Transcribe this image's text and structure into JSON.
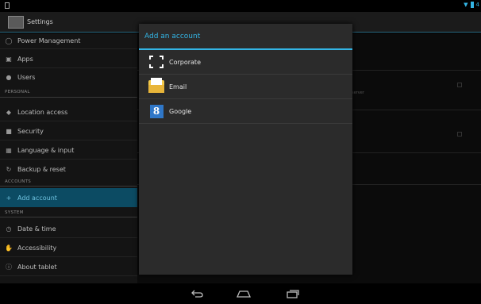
{
  "status_bar": {
    "notification_icon": "notification-icon",
    "wifi_icon": "wifi-icon",
    "battery_icon": "battery-icon",
    "clock": "4"
  },
  "action_bar": {
    "title": "Settings"
  },
  "sidebar": {
    "items_top": [
      {
        "label": "Power Management",
        "icon": "power-icon"
      },
      {
        "label": "Apps",
        "icon": "apps-icon"
      },
      {
        "label": "Users",
        "icon": "users-icon"
      }
    ],
    "section_personal": "PERSONAL",
    "items_personal": [
      {
        "label": "Location access",
        "icon": "location-icon"
      },
      {
        "label": "Security",
        "icon": "lock-icon"
      },
      {
        "label": "Language & input",
        "icon": "keyboard-icon"
      },
      {
        "label": "Backup & reset",
        "icon": "backup-icon"
      }
    ],
    "section_accounts": "ACCOUNTS",
    "items_accounts": [
      {
        "label": "Add account",
        "icon": "plus-icon",
        "selected": true
      }
    ],
    "section_system": "SYSTEM",
    "items_system": [
      {
        "label": "Date & time",
        "icon": "clock-icon"
      },
      {
        "label": "Accessibility",
        "icon": "accessibility-icon"
      },
      {
        "label": "About tablet",
        "icon": "info-icon"
      }
    ]
  },
  "content": {
    "ghost_text": "server"
  },
  "dialog": {
    "title": "Add an account",
    "options": [
      {
        "label": "Corporate",
        "icon": "corporate-icon"
      },
      {
        "label": "Email",
        "icon": "email-icon"
      },
      {
        "label": "Google",
        "icon": "google-icon",
        "icon_letter": "8"
      }
    ]
  },
  "nav_bar": {
    "back": "back-icon",
    "home": "home-icon",
    "recent": "recent-apps-icon"
  },
  "colors": {
    "accent": "#33b5e5",
    "selected_row": "#0c4b63",
    "dialog_bg": "#2b2b2b"
  }
}
